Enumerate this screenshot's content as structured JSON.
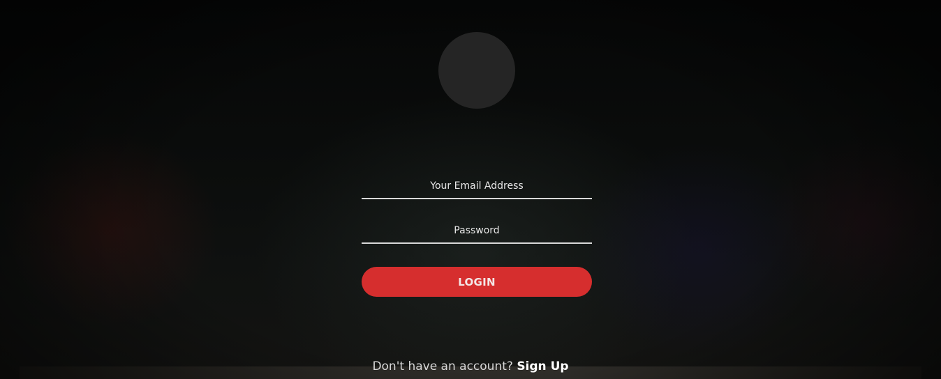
{
  "login_form": {
    "email_placeholder": "Your Email Address",
    "email_value": "",
    "password_placeholder": "Password",
    "password_value": "",
    "login_button_label": "LOGIN"
  },
  "signup": {
    "prompt": "Don't have an account?",
    "link_label": "Sign Up"
  },
  "colors": {
    "accent": "#d62e2e",
    "background": "#050606",
    "avatar": "#252525"
  }
}
